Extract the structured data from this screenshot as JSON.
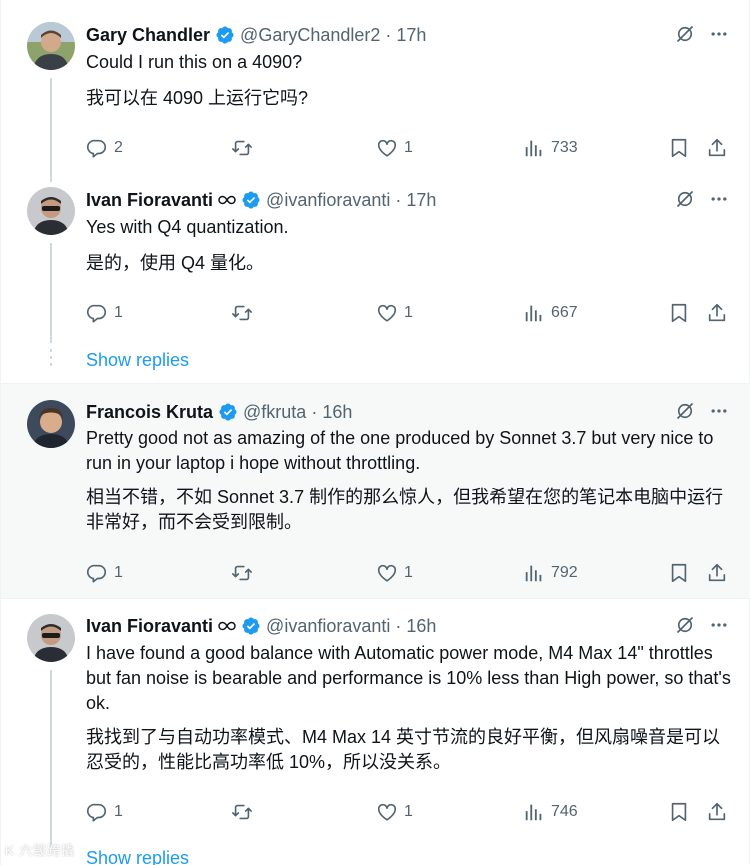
{
  "colors": {
    "accent": "#1d9bf0",
    "muted": "#536471",
    "text": "#0f1419",
    "highlight_bg": "#f7f9f9"
  },
  "tweets": [
    {
      "name": "Gary Chandler",
      "handle": "@GaryChandler2",
      "time": "· 17h",
      "text_en": "Could I run this on a 4090?",
      "text_zh": "我可以在 4090 上运行它吗?",
      "replies": "2",
      "reposts": "",
      "likes": "1",
      "views": "733"
    },
    {
      "name": "Ivan Fioravanti",
      "handle": "@ivanfioravanti",
      "time": "· 17h",
      "text_en": "Yes with Q4 quantization.",
      "text_zh": "是的，使用 Q4 量化。",
      "replies": "1",
      "reposts": "",
      "likes": "1",
      "views": "667",
      "show_replies": "Show replies"
    },
    {
      "name": "Francois Kruta",
      "handle": "@fkruta",
      "time": "· 16h",
      "text_en": "Pretty good not as amazing of the one produced by Sonnet 3.7 but very nice to run in your laptop i hope without throttling.",
      "text_zh": "相当不错，不如 Sonnet 3.7 制作的那么惊人，但我希望在您的笔记本电脑中运行非常好，而不会受到限制。",
      "replies": "1",
      "reposts": "",
      "likes": "1",
      "views": "792"
    },
    {
      "name": "Ivan Fioravanti",
      "handle": "@ivanfioravanti",
      "time": "· 16h",
      "text_en": "I have found a good balance with Automatic power mode, M4 Max 14\" throttles but fan noise is bearable and performance is 10% less than High power, so that's ok.",
      "text_zh": "我找到了与自动功率模式、M4 Max 14 英寸节流的良好平衡，但风扇噪音是可以忍受的，性能比高功率低 10%，所以没关系。",
      "replies": "1",
      "reposts": "",
      "likes": "1",
      "views": "746",
      "show_replies": "Show replies"
    }
  ],
  "watermark": "K  六毁跨撬"
}
